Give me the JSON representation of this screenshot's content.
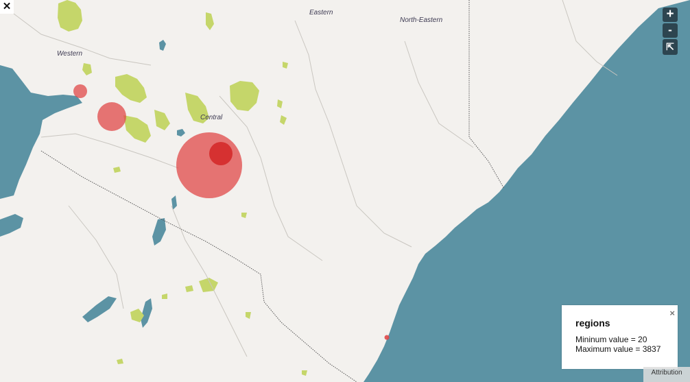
{
  "map": {
    "region_labels": [
      "Western",
      "Eastern",
      "North-Eastern",
      "Central"
    ],
    "bubbles": [
      {
        "region": "",
        "value": null
      },
      {
        "region": "",
        "value": null
      },
      {
        "region": "",
        "value": null
      },
      {
        "region": "",
        "value": null
      },
      {
        "region": "",
        "value": null
      }
    ],
    "colors": {
      "water": "#5c93a4",
      "land": "#f3f1ee",
      "vegetation": "#c5d66a",
      "bubble": "#e04848",
      "control": "#2d4550"
    }
  },
  "controls": {
    "close_label": "✕",
    "zoom_in_label": "+",
    "zoom_out_label": "-",
    "reset_icon": "expand-arrow-icon",
    "reset_label": "⇱"
  },
  "legend": {
    "title": "regions",
    "close_label": "×",
    "min_text": "Mininum value = 20",
    "max_text": "Maximum value = 3837"
  },
  "attribution": {
    "label": "Attribution"
  }
}
